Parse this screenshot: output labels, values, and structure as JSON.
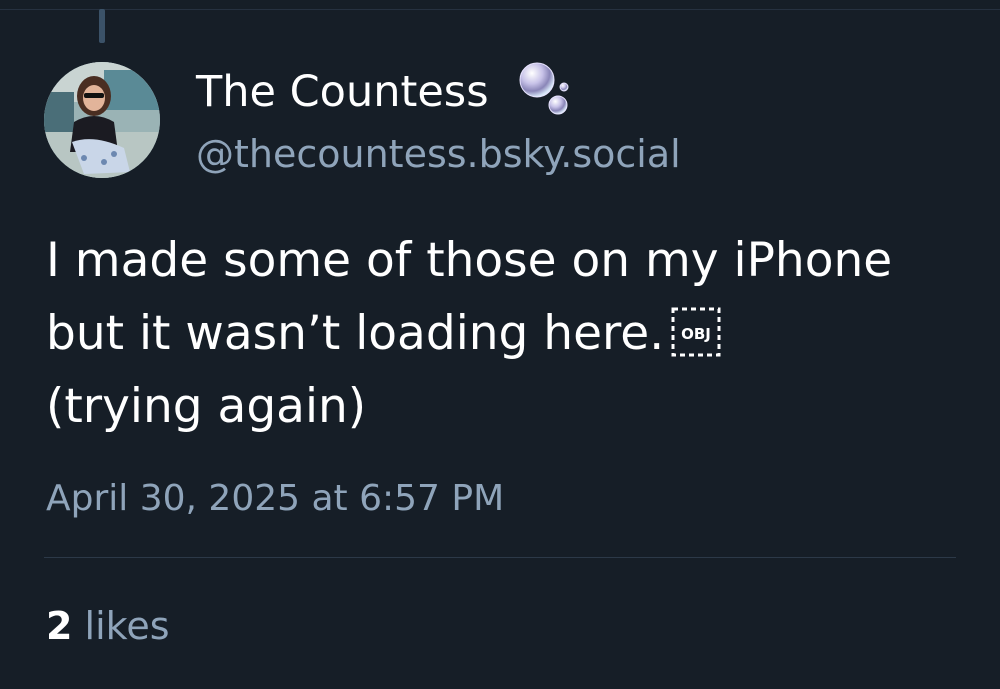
{
  "post": {
    "author": {
      "display_name": "The Countess",
      "handle": "@thecountess.bsky.social",
      "name_emoji_icon": "bubbles-icon",
      "avatar": "avatar-photo"
    },
    "text_lines": [
      "I made some of those on my iPhone",
      "but it wasn’t loading here.",
      "(trying again)"
    ],
    "inline_icon": "object-replacement-icon",
    "timestamp": "April 30, 2025 at 6:57 PM",
    "likes": {
      "count": "2",
      "label": "likes"
    }
  },
  "colors": {
    "background": "#161e27",
    "text_primary": "#ffffff",
    "text_secondary": "#8fa4ba",
    "divider": "#2c3948",
    "thread_line": "#3b5268"
  }
}
